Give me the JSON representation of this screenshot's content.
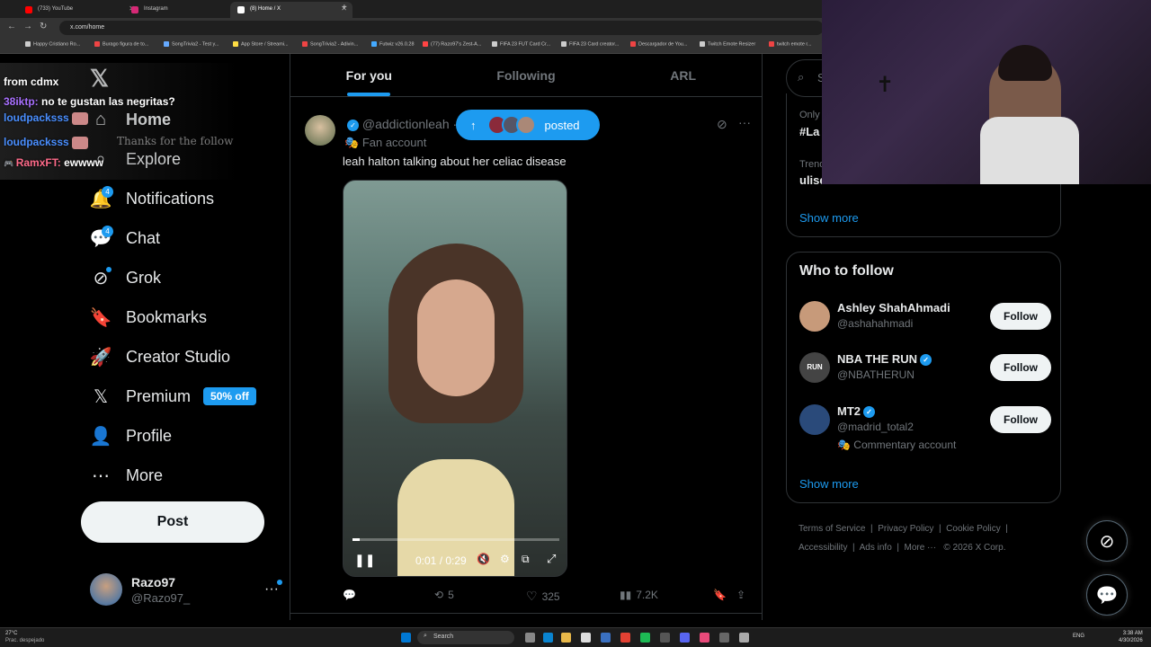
{
  "browser": {
    "tabs": [
      {
        "label": "(733) YouTube",
        "color": "#ff0000"
      },
      {
        "label": "Instagram",
        "color": "#d62976"
      },
      {
        "label": "(8) Home / X",
        "color": "#ffffff"
      }
    ],
    "url": "x.com/home",
    "bookmarks": [
      "Happy Cristiano Ro...",
      "Burago figura de to...",
      "SongTrivia2 - Test y...",
      "App Store / Streami...",
      "SongTrivia2 - Adivin...",
      "Futwiz v26.0.28",
      "(77) Razo97's Zest-A...",
      "FIFA 23 FUT Card Cr...",
      "FIFA 23 Card creator...",
      "Descargador de You...",
      "Twitch Emote Resizer",
      "twitch emote r..."
    ]
  },
  "chat": {
    "lines": [
      {
        "user": "",
        "msg": "from cdmx",
        "user_color": "#fff"
      },
      {
        "user": "38iktp:",
        "msg": "no te gustan las negritas?",
        "user_color": "#a970ff"
      },
      {
        "user": "loudpacksss",
        "msg": "",
        "user_color": "#4a8fff"
      },
      {
        "user": "loudpacksss",
        "msg": "",
        "user_color": "#4a8fff"
      },
      {
        "user": "RamxFT:",
        "msg": "ewwww",
        "user_color": "#ff6b8a"
      }
    ],
    "alert": "Thanks for the follow"
  },
  "nav": {
    "items": [
      {
        "label": "Home",
        "icon": "home-icon",
        "badge": ""
      },
      {
        "label": "Explore",
        "icon": "search-icon",
        "badge": ""
      },
      {
        "label": "Notifications",
        "icon": "bell-icon",
        "badge": "4"
      },
      {
        "label": "Chat",
        "icon": "chat-icon",
        "badge": "4"
      },
      {
        "label": "Grok",
        "icon": "grok-icon",
        "badge": ""
      },
      {
        "label": "Bookmarks",
        "icon": "bookmark-icon",
        "badge": ""
      },
      {
        "label": "Creator Studio",
        "icon": "rocket-icon",
        "badge": ""
      },
      {
        "label": "Premium",
        "icon": "x-logo-icon",
        "badge": ""
      },
      {
        "label": "Profile",
        "icon": "person-icon",
        "badge": ""
      },
      {
        "label": "More",
        "icon": "more-circle-icon",
        "badge": ""
      }
    ],
    "premium_pill": "50% off",
    "post_button": "Post",
    "account": {
      "name": "Razo97",
      "handle": "@Razo97_"
    }
  },
  "feed": {
    "tabs": [
      "For you",
      "Following",
      "ARL"
    ],
    "active_tab": "For you",
    "posted_pill": "posted",
    "post": {
      "handle": "@addictionleah",
      "separator": "·",
      "label": "Fan account",
      "text": "leah halton talking about her celiac disease",
      "video_time": "0:01 / 0:29",
      "progress": 0.034,
      "replies": "",
      "reposts": "5",
      "likes": "325",
      "views": "7.2K"
    }
  },
  "sidebar": {
    "search_placeholder": "Se",
    "trend_partial_1_label": "Only",
    "trend_partial_1": "#La",
    "trend_partial_2_label": "Trend",
    "trend_partial_2": "ulise",
    "show_more_1": "Show more",
    "who_to_follow_title": "Who to follow",
    "who_to_follow": [
      {
        "name": "Ashley ShahAhmadi",
        "handle": "@ashahahmadi",
        "verified": false,
        "sub": "",
        "button": "Follow",
        "avatar_color": "#c79a7a"
      },
      {
        "name": "NBA THE RUN",
        "handle": "@NBATHERUN",
        "verified": true,
        "sub": "",
        "button": "Follow",
        "avatar_color": "#444"
      },
      {
        "name": "MT2",
        "handle": "@madrid_total2",
        "verified": true,
        "sub": "Commentary account",
        "button": "Follow",
        "avatar_color": "#2a4a7a"
      }
    ],
    "show_more_2": "Show more",
    "footer": [
      "Terms of Service",
      "Privacy Policy",
      "Cookie Policy",
      "Accessibility",
      "Ads info",
      "More ···",
      "© 2026 X Corp."
    ]
  },
  "taskbar": {
    "weather_temp": "27°C",
    "weather_desc": "Prac. despejado",
    "search": "Search",
    "lang": "ENG",
    "time": "3:38 AM",
    "date": "4/30/2026"
  }
}
